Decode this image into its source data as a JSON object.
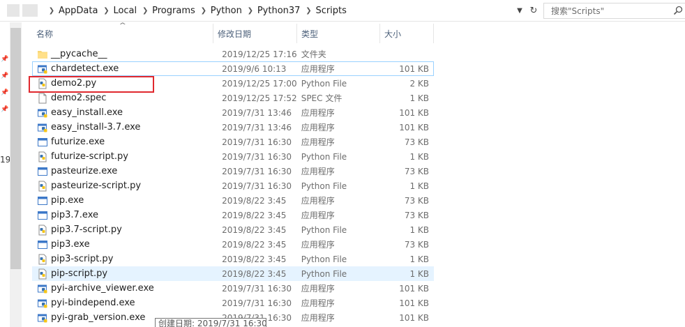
{
  "address_bar": {
    "breadcrumbs": [
      "AppData",
      "Local",
      "Programs",
      "Python",
      "Python37",
      "Scripts"
    ],
    "search_placeholder": "搜索\"Scripts\""
  },
  "left_pane": {
    "cut_text": "19"
  },
  "columns": {
    "name": "名称",
    "date": "修改日期",
    "type": "类型",
    "size": "大小"
  },
  "files": [
    {
      "name": "__pycache__",
      "date": "2019/12/25 17:16",
      "type": "文件夹",
      "size": "",
      "icon": "folder-icon"
    },
    {
      "name": "chardetect.exe",
      "date": "2019/9/6 10:13",
      "type": "应用程序",
      "size": "101 KB",
      "icon": "python-exe-icon"
    },
    {
      "name": "demo2.py",
      "date": "2019/12/25 17:00",
      "type": "Python File",
      "size": "2 KB",
      "icon": "python-file-icon"
    },
    {
      "name": "demo2.spec",
      "date": "2019/12/25 17:52",
      "type": "SPEC 文件",
      "size": "1 KB",
      "icon": "blank-file-icon"
    },
    {
      "name": "easy_install.exe",
      "date": "2019/7/31 13:46",
      "type": "应用程序",
      "size": "101 KB",
      "icon": "python-exe-icon"
    },
    {
      "name": "easy_install-3.7.exe",
      "date": "2019/7/31 13:46",
      "type": "应用程序",
      "size": "101 KB",
      "icon": "python-exe-icon"
    },
    {
      "name": "futurize.exe",
      "date": "2019/7/31 16:30",
      "type": "应用程序",
      "size": "73 KB",
      "icon": "exe-window-icon"
    },
    {
      "name": "futurize-script.py",
      "date": "2019/7/31 16:30",
      "type": "Python File",
      "size": "1 KB",
      "icon": "python-file-icon"
    },
    {
      "name": "pasteurize.exe",
      "date": "2019/7/31 16:30",
      "type": "应用程序",
      "size": "73 KB",
      "icon": "exe-window-icon"
    },
    {
      "name": "pasteurize-script.py",
      "date": "2019/7/31 16:30",
      "type": "Python File",
      "size": "1 KB",
      "icon": "python-file-icon"
    },
    {
      "name": "pip.exe",
      "date": "2019/8/22 3:45",
      "type": "应用程序",
      "size": "73 KB",
      "icon": "exe-window-icon"
    },
    {
      "name": "pip3.7.exe",
      "date": "2019/8/22 3:45",
      "type": "应用程序",
      "size": "73 KB",
      "icon": "exe-window-icon"
    },
    {
      "name": "pip3.7-script.py",
      "date": "2019/8/22 3:45",
      "type": "Python File",
      "size": "1 KB",
      "icon": "python-file-icon"
    },
    {
      "name": "pip3.exe",
      "date": "2019/8/22 3:45",
      "type": "应用程序",
      "size": "73 KB",
      "icon": "exe-window-icon"
    },
    {
      "name": "pip3-script.py",
      "date": "2019/8/22 3:45",
      "type": "Python File",
      "size": "1 KB",
      "icon": "python-file-icon"
    },
    {
      "name": "pip-script.py",
      "date": "2019/8/22 3:45",
      "type": "Python File",
      "size": "1 KB",
      "icon": "python-file-icon"
    },
    {
      "name": "pyi-archive_viewer.exe",
      "date": "2019/7/31 16:30",
      "type": "应用程序",
      "size": "101 KB",
      "icon": "python-exe-icon"
    },
    {
      "name": "pyi-bindepend.exe",
      "date": "2019/7/31 16:30",
      "type": "应用程序",
      "size": "101 KB",
      "icon": "python-exe-icon"
    },
    {
      "name": "pyi-grab_version.exe",
      "date": "2019/7/31 16:30",
      "type": "应用程序",
      "size": "101 KB",
      "icon": "python-exe-icon"
    }
  ],
  "tooltip": {
    "text": "创建日期: 2019/7/31 16:30"
  },
  "colors": {
    "highlight_box": "#e0282e",
    "selection": "#e5f3ff",
    "focus_border": "#99d1ff",
    "header_text": "#4c607a"
  }
}
